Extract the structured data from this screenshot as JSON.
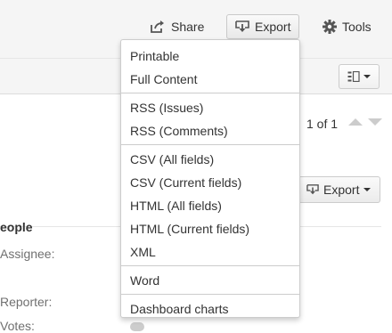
{
  "topbar": {
    "share_label": "Share",
    "export_label": "Export",
    "tools_label": "Tools"
  },
  "issue": {
    "pager_text": "1 of 1",
    "export_label": "Export"
  },
  "people": {
    "title": "eople",
    "assignee_label": "Assignee:",
    "reporter_label": "Reporter:",
    "votes_label": "Votes:"
  },
  "export_menu": {
    "groups": [
      [
        "Printable",
        "Full Content"
      ],
      [
        "RSS (Issues)",
        "RSS (Comments)"
      ],
      [
        "CSV (All fields)",
        "CSV (Current fields)",
        "HTML (All fields)",
        "HTML (Current fields)",
        "XML"
      ],
      [
        "Word"
      ],
      [
        "Dashboard charts"
      ]
    ]
  },
  "colors": {
    "toolbar_bg": "#f5f5f5",
    "text": "#333333",
    "label_gray": "#707070",
    "arrow_gray": "#cccccc"
  }
}
